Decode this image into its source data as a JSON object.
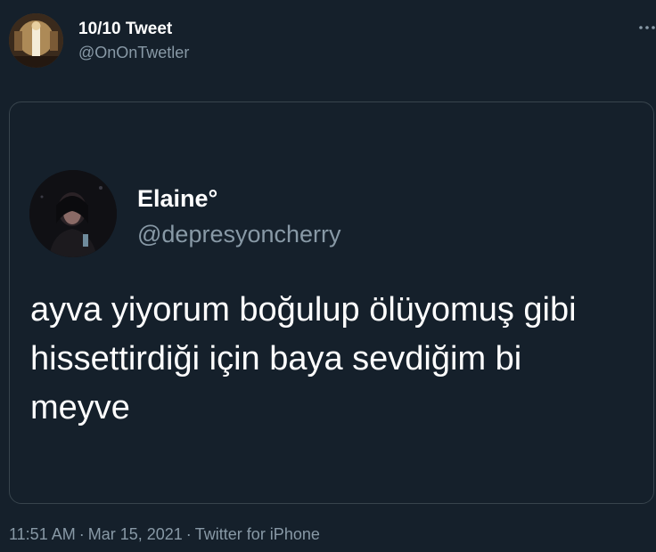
{
  "author": {
    "display_name": "10/10 Tweet",
    "handle": "@OnOnTwetler"
  },
  "quoted_tweet": {
    "display_name": "Elaine°",
    "handle": "@depresyoncherry",
    "text": "ayva yiyorum boğulup ölüyomuş gibi\nhissettirdiği için baya sevdiğim bi\nmeyve"
  },
  "meta": {
    "time": "11:51 AM",
    "separator": "·",
    "date": "Mar 15, 2021",
    "source": "Twitter for iPhone"
  },
  "icons": {
    "more": "more-options-icon"
  },
  "colors": {
    "background": "#15202b",
    "primary_text": "#ffffff",
    "secondary_text": "#8899a6",
    "border": "#38444d"
  }
}
